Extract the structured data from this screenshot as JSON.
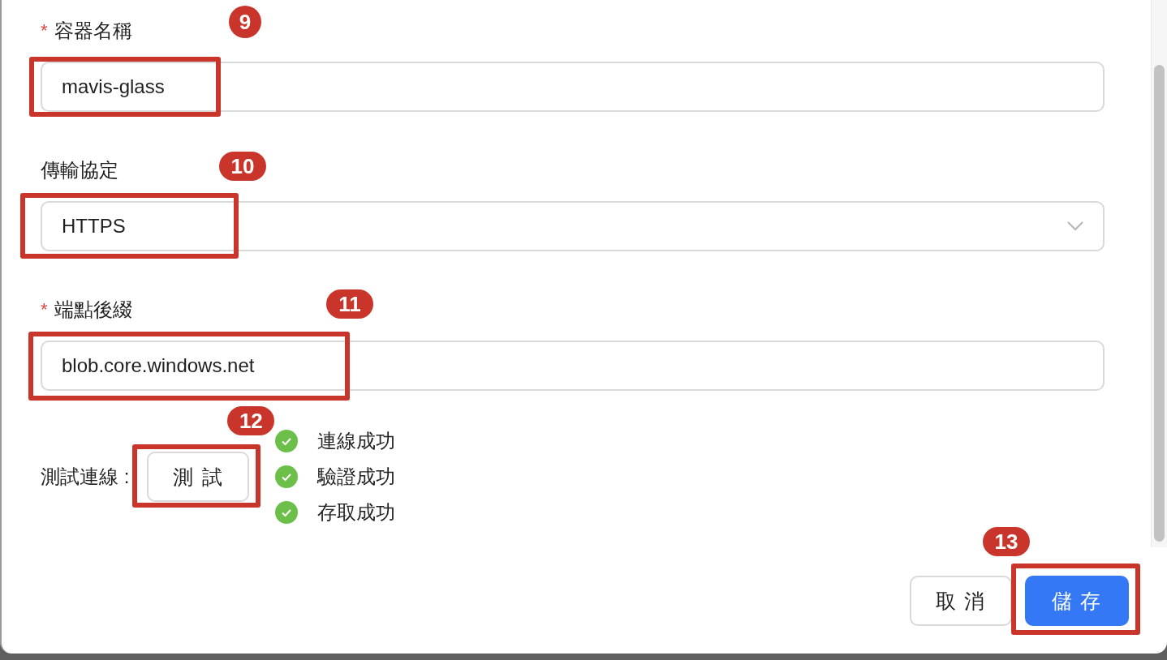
{
  "fields": [
    {
      "kind": "input",
      "required_mark": "*",
      "label": "容器名稱",
      "value": "mavis-glass",
      "marker": "9"
    },
    {
      "kind": "select",
      "label": "傳輸協定",
      "value": "HTTPS",
      "marker": "10"
    },
    {
      "kind": "input",
      "required_mark": "*",
      "label": "端點後綴",
      "value": "blob.core.windows.net",
      "marker": "11"
    }
  ],
  "test": {
    "label": "測試連線 :",
    "button": "測 試",
    "marker": "12",
    "results": [
      {
        "label": "連線成功"
      },
      {
        "label": "驗證成功"
      },
      {
        "label": "存取成功"
      }
    ]
  },
  "footer": {
    "cancel": "取 消",
    "save": "儲 存",
    "marker": "13"
  }
}
